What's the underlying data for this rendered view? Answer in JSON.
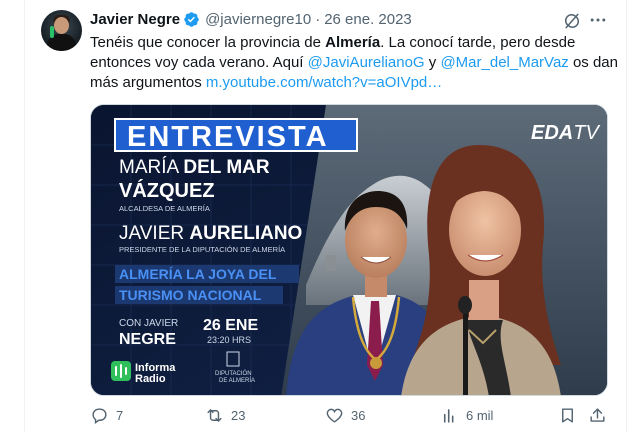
{
  "author": {
    "name": "Javier Negre",
    "handle": "@javiernegre10",
    "separator": "·",
    "date": "26 ene. 2023"
  },
  "tweet": {
    "part1": "Tenéis que conocer la provincia de ",
    "bold1": "Almería",
    "part2": ". La conocí tarde, pero desde entonces voy cada verano. Aquí ",
    "mention1": "@JaviAurelianoG",
    "part3": " y ",
    "mention2": "@Mar_del_MarVaz",
    "part4": " os dan más argumentos ",
    "link": "m.youtube.com/watch?v=aOIVpd…"
  },
  "media": {
    "banner": "ENTREVISTA",
    "guest1_first": "MARÍA ",
    "guest1_bold": "DEL MAR",
    "guest1_last": "VÁZQUEZ",
    "guest1_role": "ALCALDESA DE ALMERÍA",
    "guest2_first": "JAVIER ",
    "guest2_bold": "AURELIANO",
    "guest2_role": "PRESIDENTE DE LA DIPUTACIÓN DE ALMERÍA",
    "headline1": "ALMERÍA LA JOYA DEL",
    "headline2": "TURISMO NACIONAL",
    "with_label": "CON JAVIER",
    "host": "NEGRE",
    "air_date": "26 ENE",
    "air_time": "23:20 HRS",
    "logo_text1": "Informa",
    "logo_text2": "Radio",
    "crest_text1": "DIPUTACIÓN",
    "crest_text2": "DE ALMERÍA",
    "brand": "EDA",
    "brand_suffix": "TV"
  },
  "actions": {
    "replies": "7",
    "reposts": "23",
    "likes": "36",
    "views": "6 mil"
  },
  "colors": {
    "verified": "#1d9bf0",
    "link": "#1d9bf0",
    "muted": "#536471",
    "banner": "#2b6fdc",
    "headline": "#4a8df0",
    "background": "#0b1730"
  }
}
